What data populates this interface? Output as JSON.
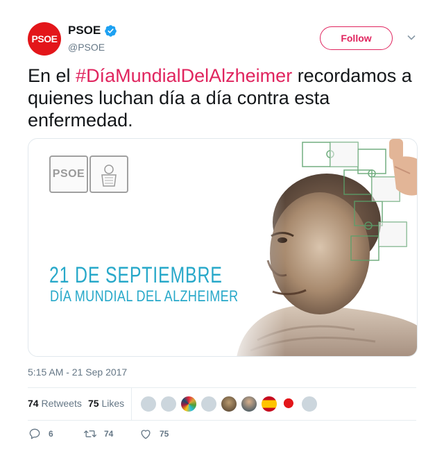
{
  "author": {
    "avatar_text": "PSOE",
    "display_name": "PSOE",
    "handle": "@PSOE",
    "verified_icon": "verified-badge-icon"
  },
  "follow_label": "Follow",
  "tweet": {
    "text_before": "En el ",
    "hashtag": "#DíaMundialDelAlzheimer",
    "text_after": " recordamos a quienes luchan día a día contra esta enfermedad."
  },
  "media": {
    "logo_text": "PSOE",
    "date_text": "21 DE SEPTIEMBRE",
    "event_text": "DÍA MUNDIAL DEL ALZHEIMER"
  },
  "timestamp": "5:15 AM - 21 Sep 2017",
  "stats": {
    "retweets_count": "74",
    "retweets_label": "Retweets",
    "likes_count": "75",
    "likes_label": "Likes"
  },
  "actions": {
    "reply_count": "6",
    "retweet_count": "74",
    "like_count": "75"
  },
  "colors": {
    "brand_red": "#e3161a",
    "hashtag": "#e0245e",
    "accent_blue": "#1da1f2",
    "event_text": "#27a8c9"
  }
}
